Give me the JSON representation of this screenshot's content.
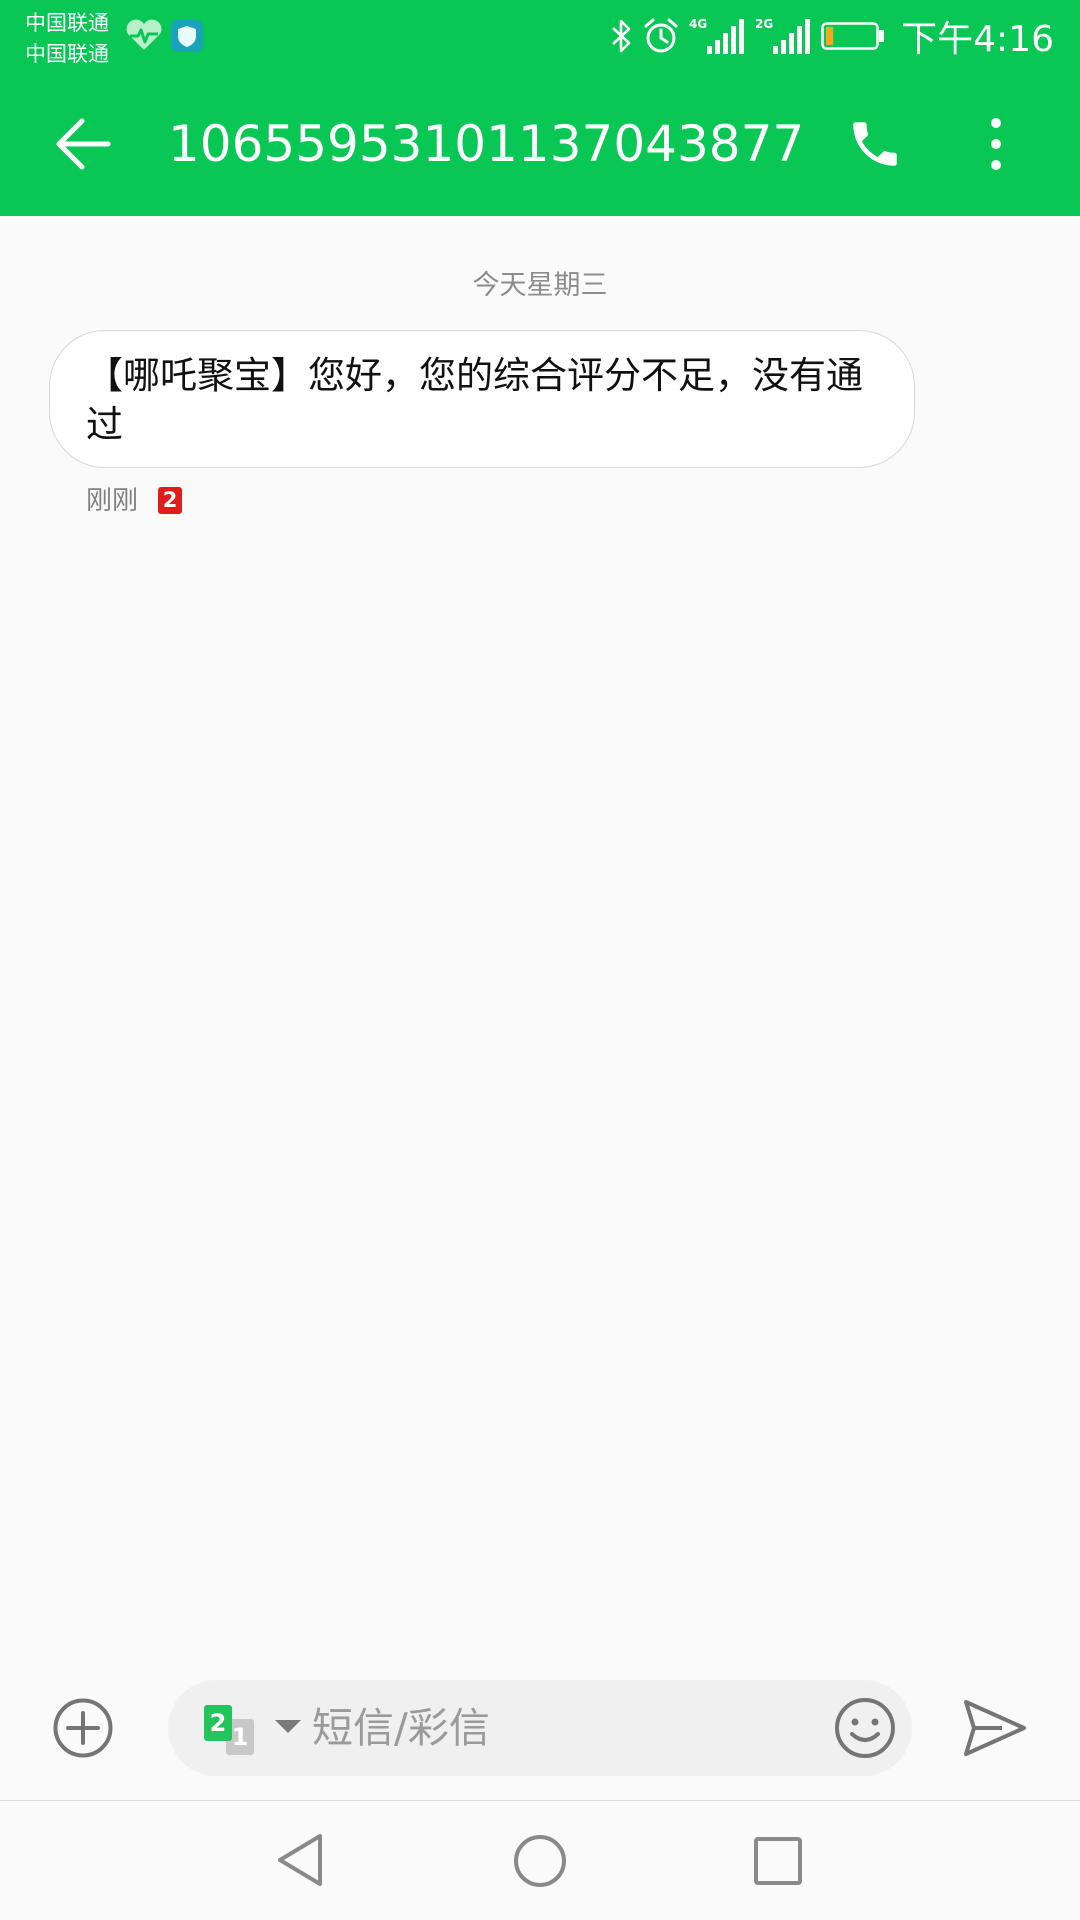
{
  "status_bar": {
    "carrier_1": "中国联通",
    "carrier_2": "中国联通",
    "network_1": "4G",
    "network_2": "2G",
    "time": "下午4:16",
    "icons": [
      "health-icon",
      "shield-icon",
      "bluetooth-icon",
      "alarm-icon",
      "signal-icon",
      "battery-icon"
    ],
    "battery_level": 0.15
  },
  "app_bar": {
    "title": "10655953101137043877",
    "icons": [
      "back-arrow-icon",
      "phone-call-icon",
      "more-vertical-icon"
    ]
  },
  "conversation": {
    "date_label": "今天星期三",
    "messages": [
      {
        "text": "【哪吒聚宝】您好，您的综合评分不足，没有通过",
        "time": "刚刚",
        "sim": "2"
      }
    ]
  },
  "compose": {
    "sim_active": "2",
    "sim_inactive": "1",
    "placeholder": "短信/彩信",
    "icons": [
      "add-attachment-icon",
      "caret-down-icon",
      "emoji-icon",
      "send-icon"
    ]
  },
  "nav_bar": {
    "icons": [
      "nav-back-icon",
      "nav-home-icon",
      "nav-recent-icon"
    ]
  },
  "colors": {
    "header_green": "#08c754",
    "sim_badge_red": "#e21b1b",
    "sim_green": "#22c45b",
    "background": "#fafafa"
  }
}
